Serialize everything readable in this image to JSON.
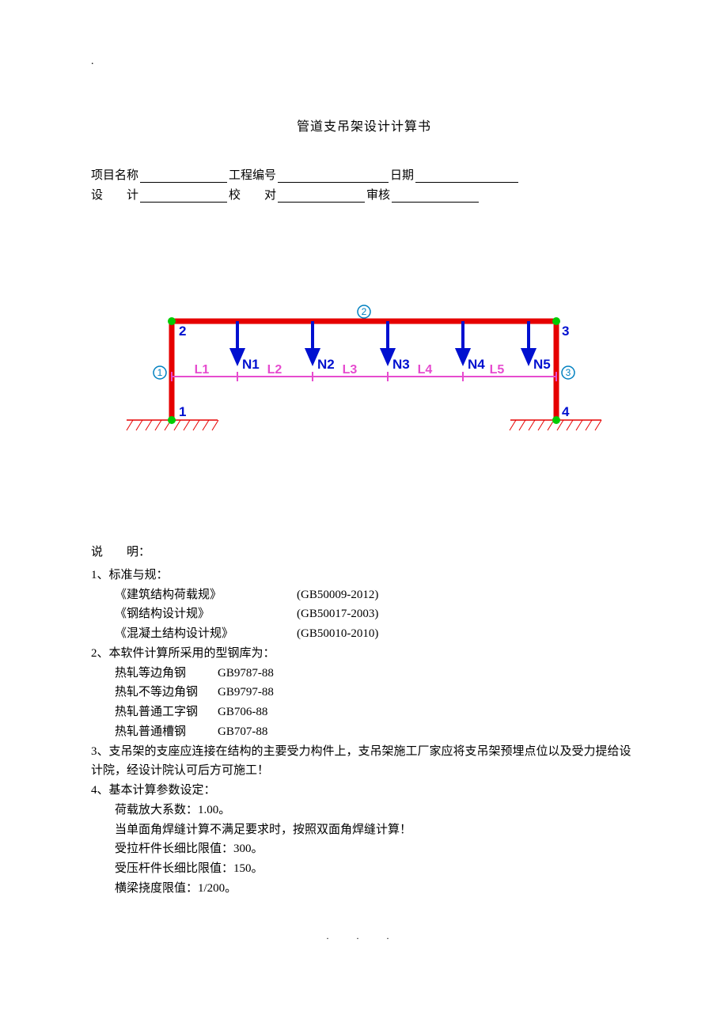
{
  "topDot": ".",
  "title": "管道支吊架设计计算书",
  "meta": {
    "projectLabel": "项目名称",
    "engNoLabel": "工程编号",
    "dateLabel": "日期",
    "designLabel": "设　　计",
    "checkLabel": "校　　对",
    "reviewLabel": "审核"
  },
  "diagram": {
    "nodes": [
      "1",
      "2",
      "3",
      "4"
    ],
    "circled": [
      "①",
      "②",
      "③"
    ],
    "forces": [
      "N1",
      "N2",
      "N3",
      "N4",
      "N5"
    ],
    "spans": [
      "L1",
      "L2",
      "L3",
      "L4",
      "L5"
    ]
  },
  "explain": {
    "heading": "说　　明：",
    "s1": {
      "title": "1、标准与规：",
      "items": [
        {
          "name": "《建筑结构荷载规》",
          "code": "(GB50009-2012)"
        },
        {
          "name": "《钢结构设计规》",
          "code": "(GB50017-2003)"
        },
        {
          "name": "《混凝土结构设计规》",
          "code": "(GB50010-2010)"
        }
      ]
    },
    "s2": {
      "title": "2、本软件计算所采用的型钢库为：",
      "items": [
        {
          "name": "热轧等边角钢",
          "code": "GB9787-88"
        },
        {
          "name": "热轧不等边角钢",
          "code": "GB9797-88"
        },
        {
          "name": "热轧普通工字钢",
          "code": "GB706-88"
        },
        {
          "name": "热轧普通槽钢",
          "code": "GB707-88"
        }
      ]
    },
    "s3": "3、支吊架的支座应连接在结构的主要受力构件上，支吊架施工厂家应将支吊架预埋点位以及受力提给设计院，经设计院认可后方可施工！",
    "s4": {
      "title": "4、基本计算参数设定：",
      "items": [
        "荷载放大系数：1.00。",
        "当单面角焊缝计算不满足要求时，按照双面角焊缝计算！",
        "受拉杆件长细比限值：300。",
        "受压杆件长细比限值：150。",
        "横梁挠度限值：1/200。"
      ]
    }
  },
  "footerDots": ". . ."
}
